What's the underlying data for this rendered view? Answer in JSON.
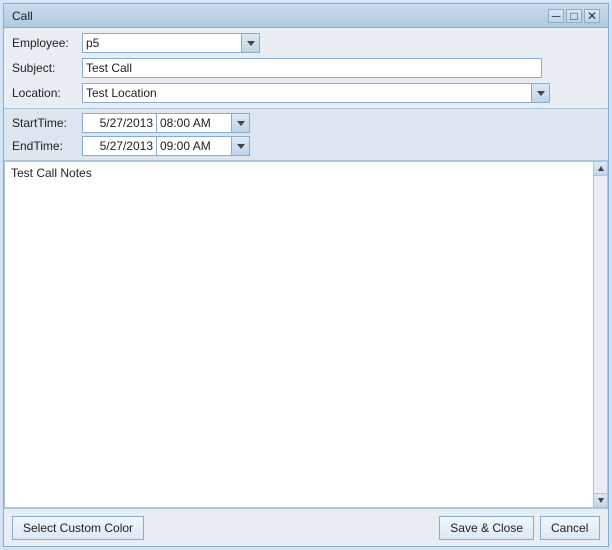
{
  "window": {
    "title": "Call",
    "title_placeholder": ""
  },
  "title_controls": {
    "minimize": "─",
    "maximize": "□",
    "close": "✕"
  },
  "form": {
    "employee_label": "Employee:",
    "employee_value": "p5",
    "subject_label": "Subject:",
    "subject_value": "Test Call",
    "location_label": "Location:",
    "location_value": "Test Location"
  },
  "datetime": {
    "start_label": "StartTime:",
    "start_date": "5/27/2013",
    "start_time": "08:00 AM",
    "end_label": "EndTime:",
    "end_date": "5/27/2013",
    "end_time": "09:00 AM"
  },
  "notes": {
    "value": "Test Call Notes"
  },
  "footer": {
    "custom_color_label": "Select Custom Color",
    "save_close_label": "Save & Close",
    "cancel_label": "Cancel"
  }
}
